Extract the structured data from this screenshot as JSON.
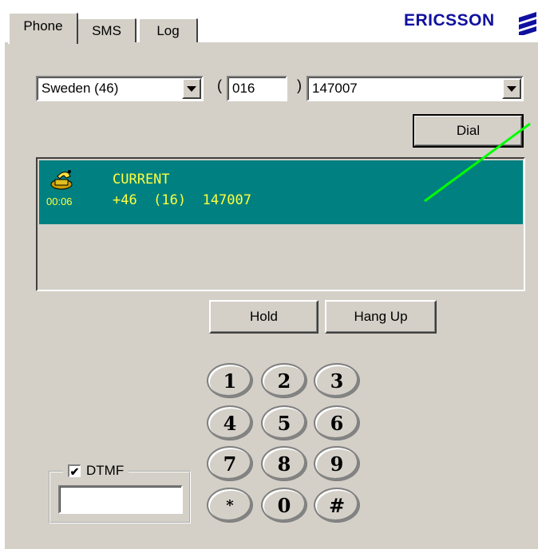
{
  "tabs": [
    {
      "label": "Phone",
      "active": true
    },
    {
      "label": "SMS",
      "active": false
    },
    {
      "label": "Log",
      "active": false
    }
  ],
  "brand": {
    "name": "ERICSSON",
    "color": "#1010a0",
    "mark_icon": "ericsson-logo-mark"
  },
  "dial_form": {
    "country": "Sweden (46)",
    "open_paren": "(",
    "area_code": "016",
    "close_paren": ")",
    "number": "147007",
    "dial_label": "Dial"
  },
  "calls": [
    {
      "status": "CURRENT",
      "duration": "00:06",
      "number": "+46  (16)  147007",
      "icon": "phone-handset-icon"
    }
  ],
  "call_actions": {
    "hold_label": "Hold",
    "hangup_label": "Hang Up"
  },
  "keypad": [
    [
      "1",
      "2",
      "3"
    ],
    [
      "4",
      "5",
      "6"
    ],
    [
      "7",
      "8",
      "9"
    ],
    [
      "*",
      "0",
      "#"
    ]
  ],
  "dtmf": {
    "label": "DTMF",
    "checked": true,
    "checkmark": "✔",
    "value": ""
  },
  "colors": {
    "call_highlight": "#008080",
    "call_text": "#ffff40",
    "annotation_line": "#00ff00",
    "panel": "#d4d0c8"
  }
}
